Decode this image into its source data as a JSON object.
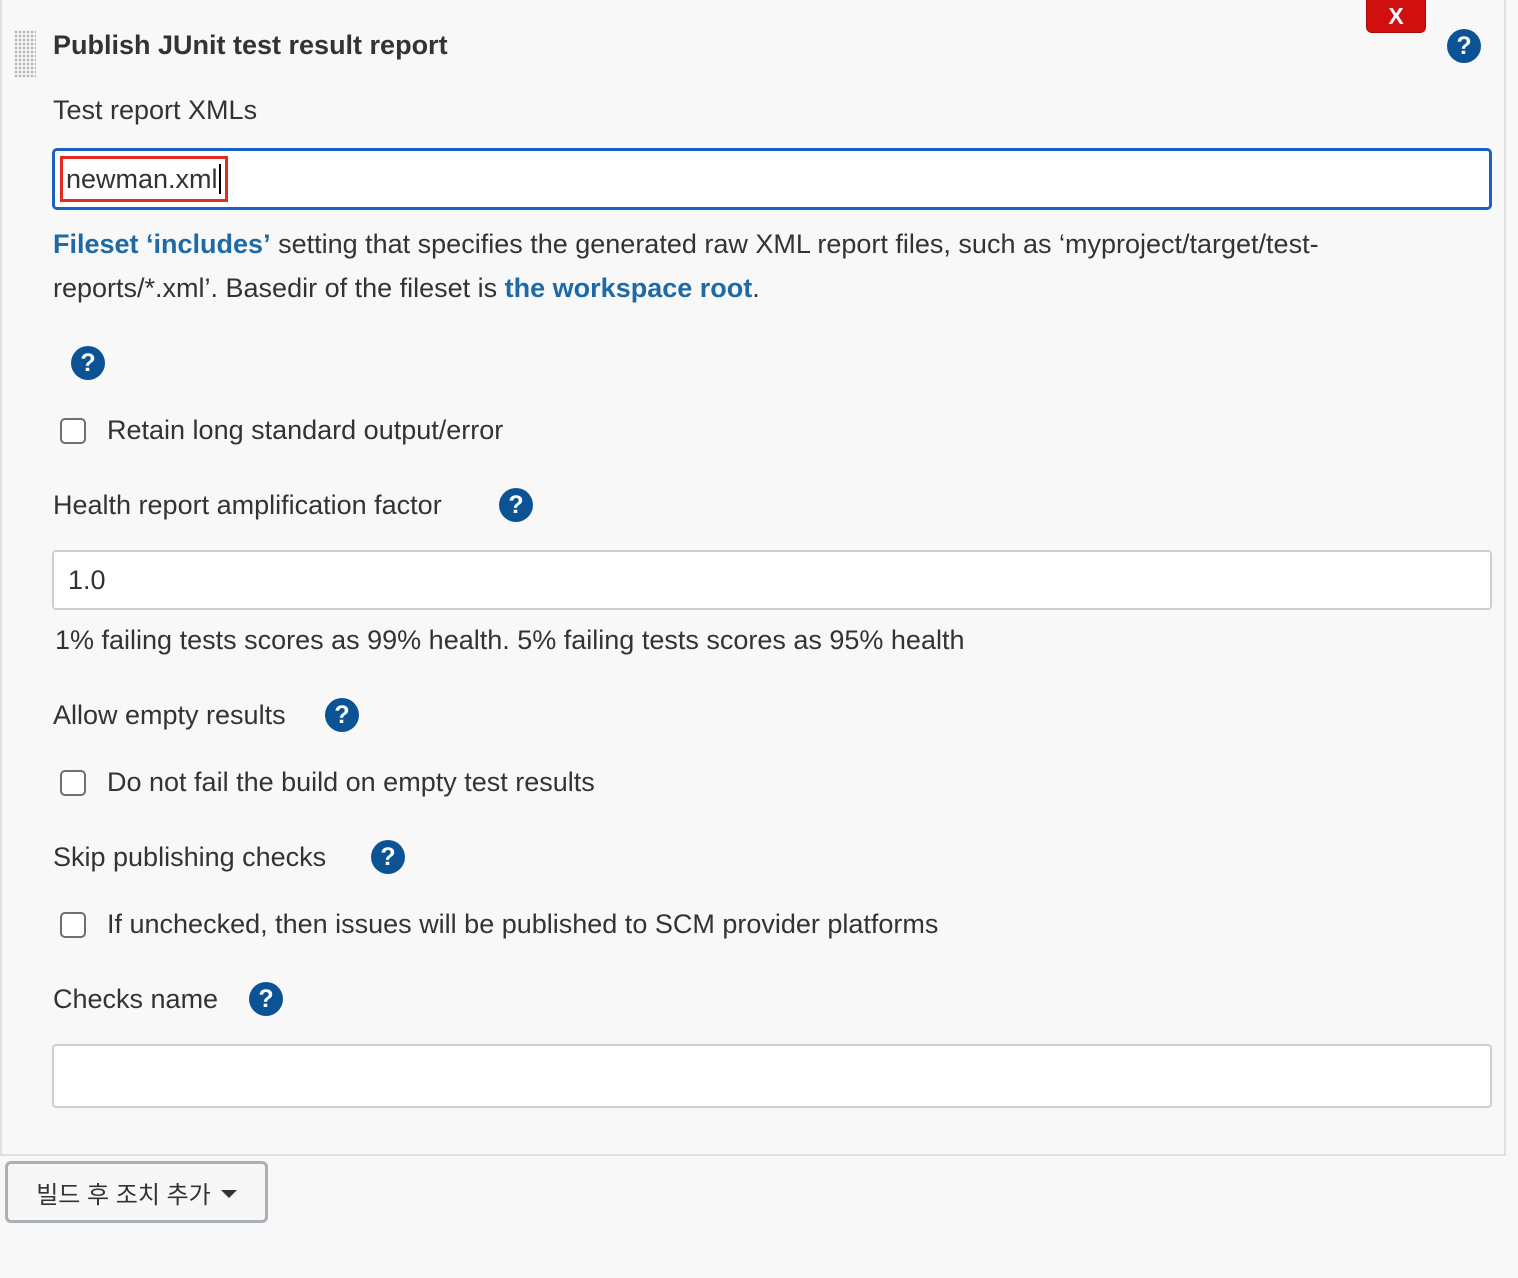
{
  "panel": {
    "title": "Publish JUnit test result report",
    "close_label": "X",
    "help_glyph": "?"
  },
  "test_report": {
    "label": "Test report XMLs",
    "value": "newman.xml",
    "description_link_fileset": "Fileset ‘includes’",
    "description_text_1": " setting that specifies the generated raw XML report files, such as ‘myproject/target/test-reports/*.xml’. Basedir of the fileset is ",
    "description_link_workspace": "the workspace root",
    "description_text_2": "."
  },
  "retain_output": {
    "label": "Retain long standard output/error",
    "checked": false
  },
  "health_report": {
    "label": "Health report amplification factor",
    "value": "1.0",
    "hint": "1% failing tests scores as 99% health. 5% failing tests scores as 95% health"
  },
  "allow_empty": {
    "label": "Allow empty results",
    "checkbox_label": "Do not fail the build on empty test results",
    "checked": false
  },
  "skip_checks": {
    "label": "Skip publishing checks",
    "checkbox_label": "If unchecked, then issues will be published to SCM provider platforms",
    "checked": false
  },
  "checks_name": {
    "label": "Checks name",
    "value": ""
  },
  "footer": {
    "add_post_build_label": "빌드 후 조치 추가"
  },
  "colors": {
    "help_icon": "#0b5394",
    "link": "#1e6aa6",
    "close_button": "#d10f0f",
    "focus_border": "#1a63c2",
    "highlight_box": "#e22d1e"
  }
}
